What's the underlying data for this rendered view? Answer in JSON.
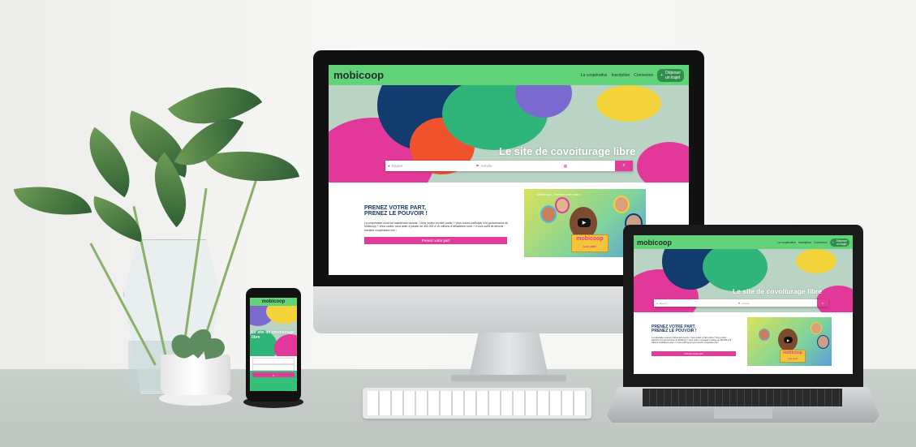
{
  "site": {
    "logo": "mobicoop",
    "nav": [
      "La coopérative",
      "Inscription",
      "Connexion"
    ],
    "depot_line1": "Déposer",
    "depot_line2": "un trajet",
    "hero_title": "Le site de covoiturage libre",
    "search_from": "Départ",
    "search_to": "Arrivée",
    "section_heading_1": "PRENEZ VOTRE PART,",
    "section_heading_2": "PRENEZ LE POUVOIR !",
    "section_text": "La coopérative vous est maintenant ouverte ! Vous voulez en faire partie ? Vous voulez participer à la gouvernance de Mobicoop ? Vous voulez nous aider à passer de 350 000 à 15 millions d'utilisateurs·rices ? Il vous suffit de devenir membre coopérateur.rice !",
    "cta": "Prenez votre part",
    "video_title": "Mobicoop - Prenez votre part !",
    "video_sign": "mobicoop",
    "video_sign_sub": "une part",
    "mobile_hero": "Le site de covoiturage libre"
  },
  "colors": {
    "brand_green": "#63d37a",
    "brand_pink": "#e03c9b",
    "heading_blue": "#1d3a6e"
  },
  "icons": [
    "play-icon",
    "search-icon",
    "map-pin-icon",
    "flag-icon",
    "calendar-icon",
    "plus-icon"
  ]
}
